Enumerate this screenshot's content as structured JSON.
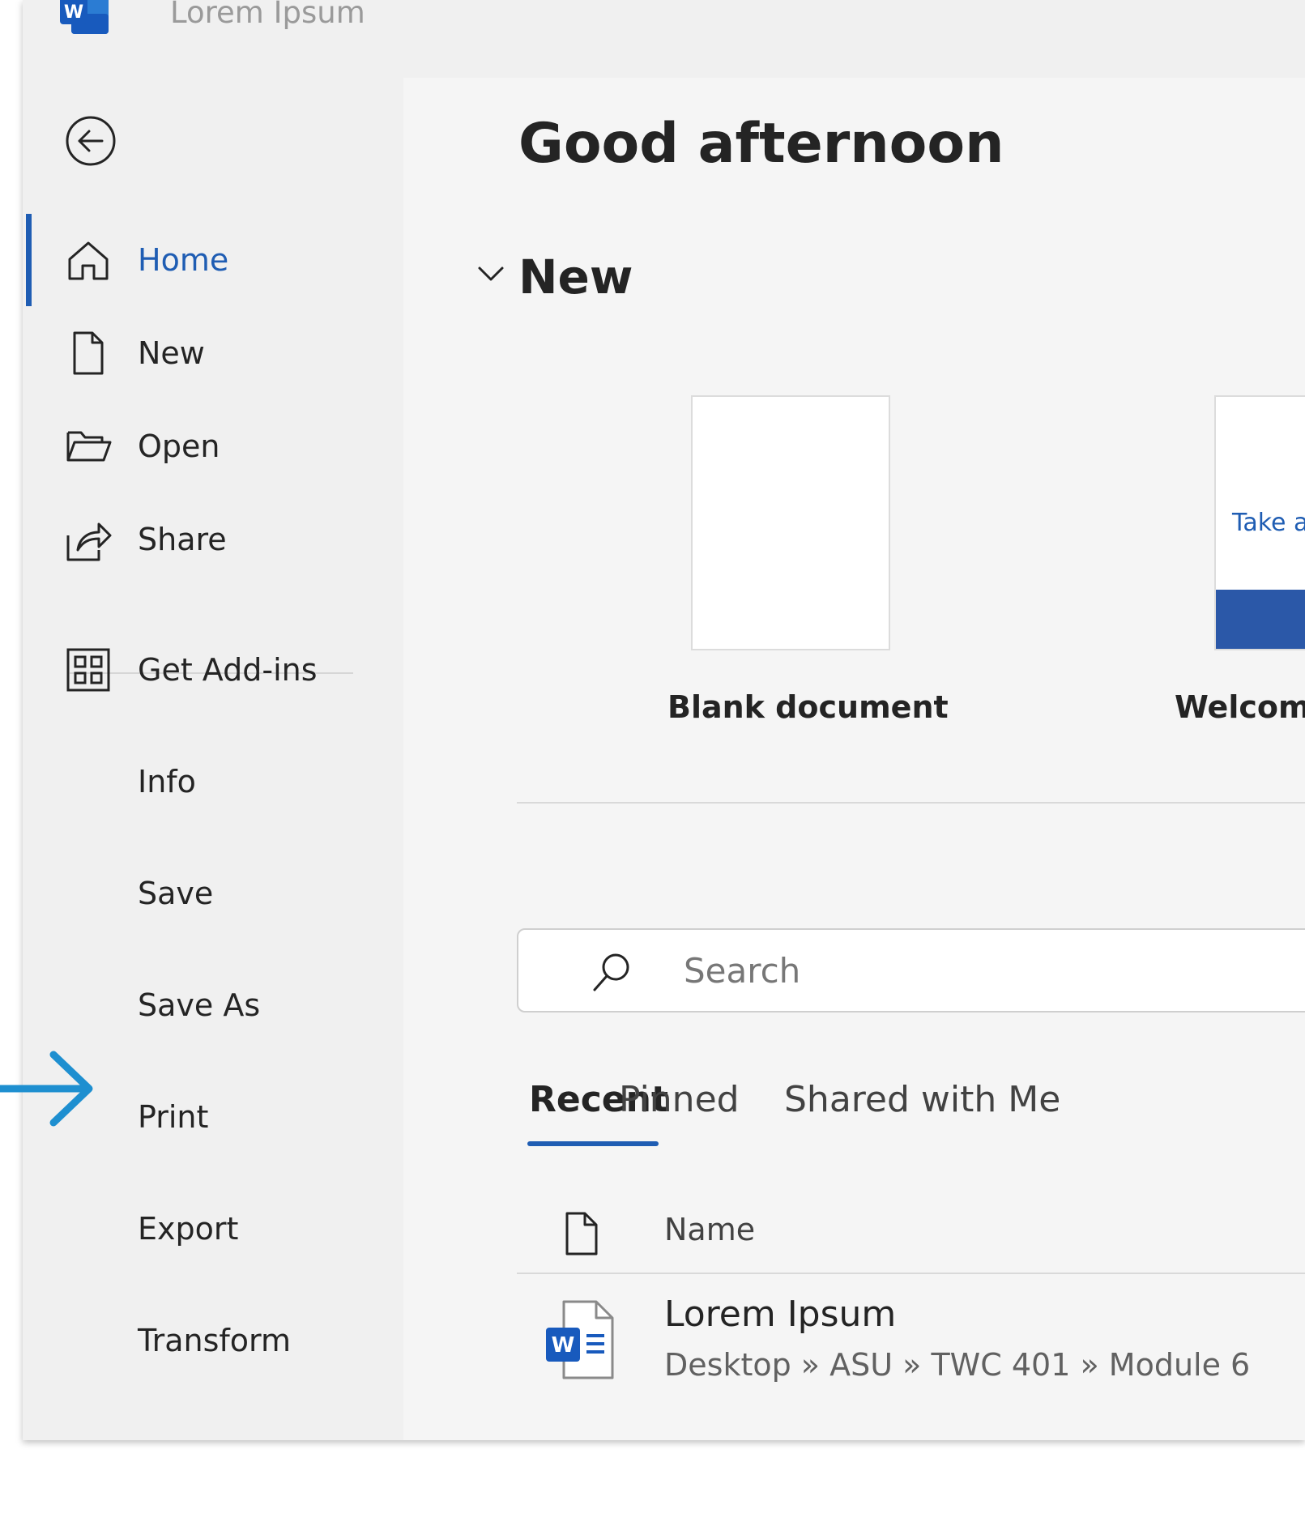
{
  "window": {
    "title": "Lorem Ipsum"
  },
  "sidebar": {
    "items": [
      {
        "label": "Home",
        "icon": "home-icon",
        "active": true
      },
      {
        "label": "New",
        "icon": "new-document-icon"
      },
      {
        "label": "Open",
        "icon": "open-folder-icon"
      },
      {
        "label": "Share",
        "icon": "share-icon"
      },
      {
        "label": "Get Add-ins",
        "icon": "add-ins-grid-icon"
      },
      {
        "label": "Info"
      },
      {
        "label": "Save"
      },
      {
        "label": "Save As"
      },
      {
        "label": "Print"
      },
      {
        "label": "Export"
      },
      {
        "label": "Transform"
      }
    ]
  },
  "main": {
    "greeting": "Good afternoon",
    "new_section": {
      "title": "New",
      "templates": [
        {
          "caption": "Blank document"
        },
        {
          "caption": "Welcome t",
          "thumbnail_text": "Take a to"
        }
      ]
    },
    "search": {
      "placeholder": "Search"
    },
    "tabs": [
      {
        "label": "Recent",
        "selected": true
      },
      {
        "label": "Pinned"
      },
      {
        "label": "Shared with Me"
      }
    ],
    "file_list": {
      "column_name": "Name",
      "files": [
        {
          "name": "Lorem Ipsum",
          "path": "Desktop » ASU » TWC 401 » Module 6"
        }
      ]
    }
  },
  "colors": {
    "accent": "#1f5db3",
    "callout_arrow": "#1e8fd0",
    "word_blue": "#185abd"
  }
}
